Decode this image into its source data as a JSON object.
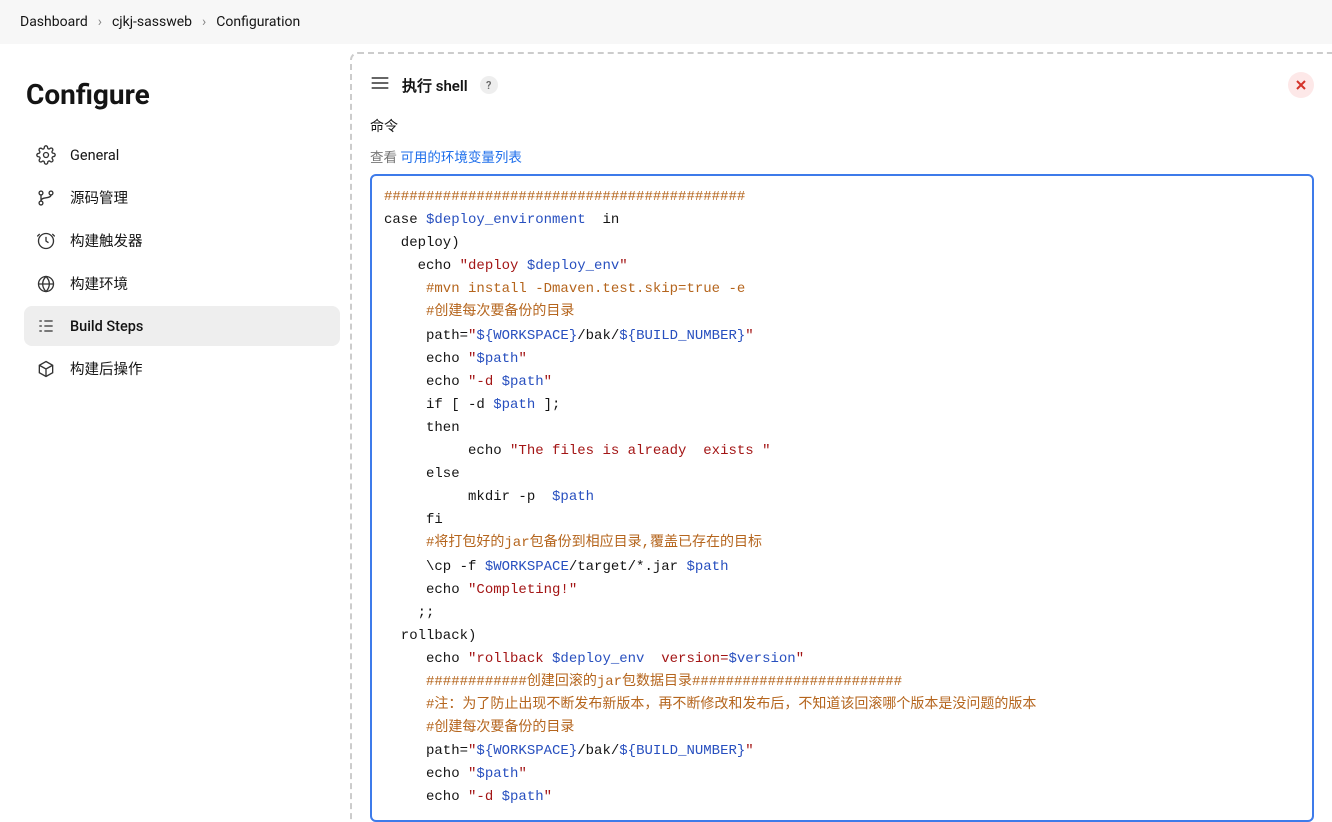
{
  "breadcrumb": {
    "items": [
      "Dashboard",
      "cjkj-sassweb",
      "Configuration"
    ]
  },
  "sidebar": {
    "title": "Configure",
    "items": [
      {
        "label": "General",
        "icon": "gear"
      },
      {
        "label": "源码管理",
        "icon": "branch"
      },
      {
        "label": "构建触发器",
        "icon": "clock"
      },
      {
        "label": "构建环境",
        "icon": "globe"
      },
      {
        "label": "Build Steps",
        "icon": "steps",
        "active": true
      },
      {
        "label": "构建后操作",
        "icon": "package"
      }
    ]
  },
  "step": {
    "title": "执行 shell",
    "help": "?",
    "field_label": "命令",
    "hint_prefix": "查看 ",
    "hint_link": "可用的环境变量列表"
  },
  "code": {
    "l01": "###########################################",
    "l02a": "case ",
    "l02b": "$deploy_environment",
    "l02c": "  in",
    "l03": "  deploy)",
    "l04a": "    echo ",
    "l04b": "\"deploy ",
    "l04c": "$deploy_env",
    "l04d": "\"",
    "l05": "     #mvn install -Dmaven.test.skip=true -e",
    "l06": "     #创建每次要备份的目录",
    "l07a": "     path=",
    "l07b": "\"",
    "l07c": "${WORKSPACE}",
    "l07d": "/bak/",
    "l07e": "${BUILD_NUMBER}",
    "l07f": "\"",
    "l08a": "     echo ",
    "l08b": "\"",
    "l08c": "$path",
    "l08d": "\"",
    "l09a": "     echo ",
    "l09b": "\"-d ",
    "l09c": "$path",
    "l09d": "\"",
    "l10a": "     if [ -d ",
    "l10b": "$path",
    "l10c": " ];",
    "l11": "     then",
    "l12a": "          echo ",
    "l12b": "\"The files is already  exists \"",
    "l13": "     else",
    "l14a": "          mkdir -p  ",
    "l14b": "$path",
    "l15": "     fi",
    "l16": "     #将打包好的jar包备份到相应目录,覆盖已存在的目标",
    "l17a": "     \\cp -f ",
    "l17b": "$WORKSPACE",
    "l17c": "/target/*.jar ",
    "l17d": "$path",
    "l18a": "     echo ",
    "l18b": "\"Completing!\"",
    "l19": "    ;;",
    "l20": "  rollback)",
    "l21a": "     echo ",
    "l21b": "\"rollback ",
    "l21c": "$deploy_env",
    "l21d": "  version=",
    "l21e": "$version",
    "l21f": "\"",
    "l22": "     ############创建回滚的jar包数据目录#########################",
    "l23": "     #注：为了防止出现不断发布新版本，再不断修改和发布后，不知道该回滚哪个版本是没问题的版本",
    "l24": "     #创建每次要备份的目录",
    "l25a": "     path=",
    "l25b": "\"",
    "l25c": "${WORKSPACE}",
    "l25d": "/bak/",
    "l25e": "${BUILD_NUMBER}",
    "l25f": "\"",
    "l26a": "     echo ",
    "l26b": "\"",
    "l26c": "$path",
    "l26d": "\"",
    "l27a": "     echo ",
    "l27b": "\"-d ",
    "l27c": "$path",
    "l27d": "\""
  }
}
